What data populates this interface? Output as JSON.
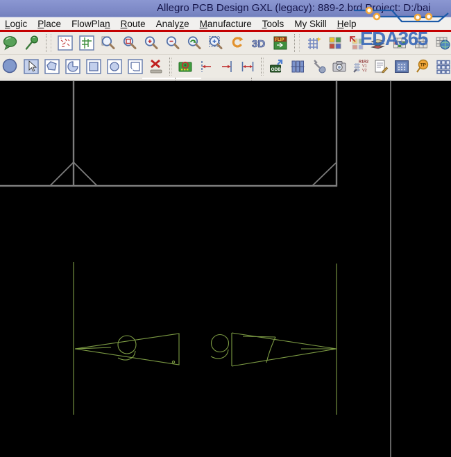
{
  "window": {
    "title": "Allegro PCB Design GXL (legacy): 889-2.brd Project: D:/bai"
  },
  "watermark": {
    "text": "EDA365"
  },
  "menubar": {
    "items": [
      {
        "label": "Logic",
        "underline": 0
      },
      {
        "label": "Place",
        "underline": 0
      },
      {
        "label": "FlowPlan",
        "underline": 7
      },
      {
        "label": "Route",
        "underline": 0
      },
      {
        "label": "Analyze",
        "underline": 5
      },
      {
        "label": "Manufacture",
        "underline": 0
      },
      {
        "label": "Tools",
        "underline": 0
      },
      {
        "label": "My Skill",
        "underline": -1
      },
      {
        "label": "Help",
        "underline": 0
      }
    ]
  },
  "toolbars": {
    "row1": [
      "comment-balloon",
      "pushpin",
      "|",
      "open-design",
      "zoom-fit",
      "zoom-points",
      "zoom-box",
      "zoom-in",
      "zoom-out",
      "zoom-previous",
      "zoom-selection",
      "undo",
      "3d-view",
      "flip-design",
      "|",
      "grid-toggle",
      "color-visibility",
      "shadow-mode",
      "layer-stack",
      "color-grid",
      "status-grid",
      "world-view"
    ],
    "row2": [
      "shape-circle-filled",
      "select-cursor",
      "shape-polygon",
      "shape-arc",
      "shape-rect",
      "shape-circle",
      "shape-unrect",
      "delete-element",
      "|",
      "highlight-board",
      "dimension-left",
      "dimension-right",
      "dimension-span",
      "|",
      "odb-export",
      "padstack-library",
      "fix-tool",
      "snapshot",
      "rename-refdes",
      "report-list",
      "panel-display",
      "testpoint",
      "pad-array"
    ]
  },
  "canvas": {
    "markings": {
      "left_digit": "9",
      "right_digit_1": "9",
      "right_digit_2": "7"
    }
  },
  "colors": {
    "titlebar": "#7e8ac7",
    "titlebar_text": "#15154a",
    "menubar_bg": "#f1f0ee",
    "accent_red": "#c40000",
    "toolbar_bg": "#edeae4",
    "watermark_blue": "#3465b8",
    "trace_blue": "#1c5aa8",
    "via_orange": "#f0a63a",
    "canvas_black": "#000000",
    "outline_gray": "#7d7d7d",
    "guide_gray": "#c6c6c6",
    "pcb_green": "#7d9c44"
  }
}
